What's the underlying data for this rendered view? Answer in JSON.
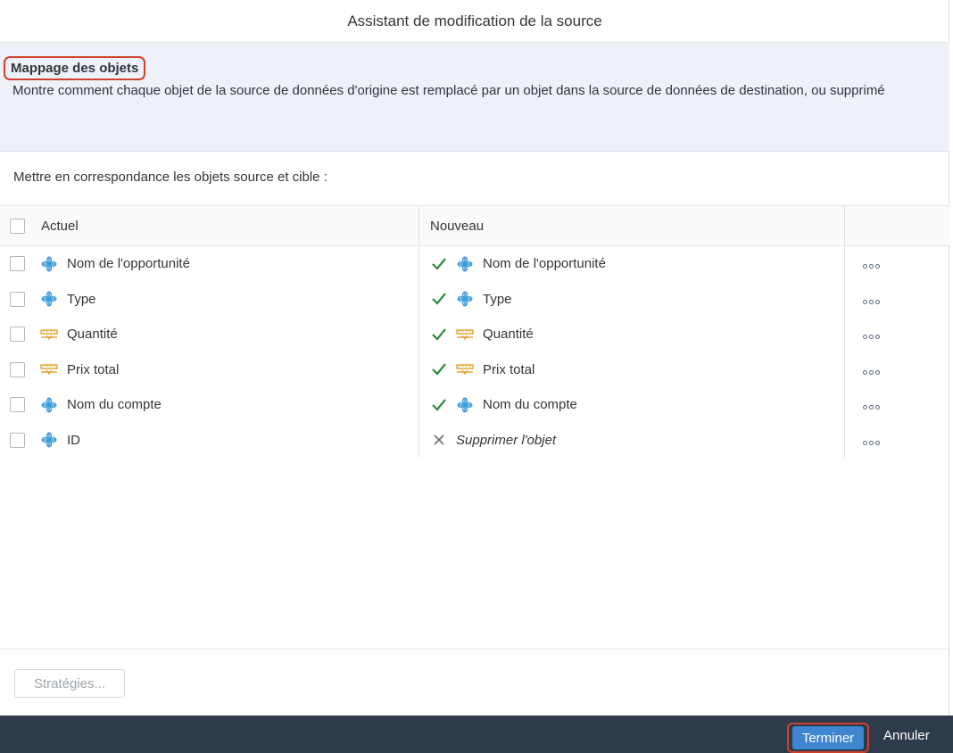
{
  "dialog": {
    "title": "Assistant de modification de la source"
  },
  "info": {
    "title": "Mappage des objets",
    "description": "Montre comment chaque objet de la source de données d'origine est remplacé par un objet dans la source de données de destination, ou supprimé"
  },
  "mapping": {
    "subtitle": "Mettre en correspondance les objets source et cible :",
    "headers": {
      "current": "Actuel",
      "new": "Nouveau"
    },
    "rows": [
      {
        "current": "Nom de l'opportunité",
        "current_icon": "dimension-icon",
        "status": "check-icon",
        "new": "Nom de l'opportunité",
        "new_icon": "dimension-icon"
      },
      {
        "current": "Type",
        "current_icon": "dimension-icon",
        "status": "check-icon",
        "new": "Type",
        "new_icon": "dimension-icon"
      },
      {
        "current": "Quantité",
        "current_icon": "measure-icon",
        "status": "check-icon",
        "new": "Quantité",
        "new_icon": "measure-icon"
      },
      {
        "current": "Prix total",
        "current_icon": "measure-icon",
        "status": "check-icon",
        "new": "Prix total",
        "new_icon": "measure-icon"
      },
      {
        "current": "Nom du compte",
        "current_icon": "dimension-icon",
        "status": "check-icon",
        "new": "Nom du compte",
        "new_icon": "dimension-icon"
      },
      {
        "current": "ID",
        "current_icon": "dimension-icon",
        "status": "cross-icon",
        "new": "Supprimer l'objet",
        "new_icon": ""
      }
    ]
  },
  "footer": {
    "strategies_label": "Stratégies...",
    "finish_label": "Terminer",
    "cancel_label": "Annuler"
  },
  "colors": {
    "dimension": "#3a9bd9",
    "measure": "#e8a63a",
    "check": "#2b8a3e",
    "cross": "#6a6d70",
    "highlight": "#d0402b",
    "bottom_bar": "#2e3b4a",
    "primary": "#3f86d0"
  }
}
